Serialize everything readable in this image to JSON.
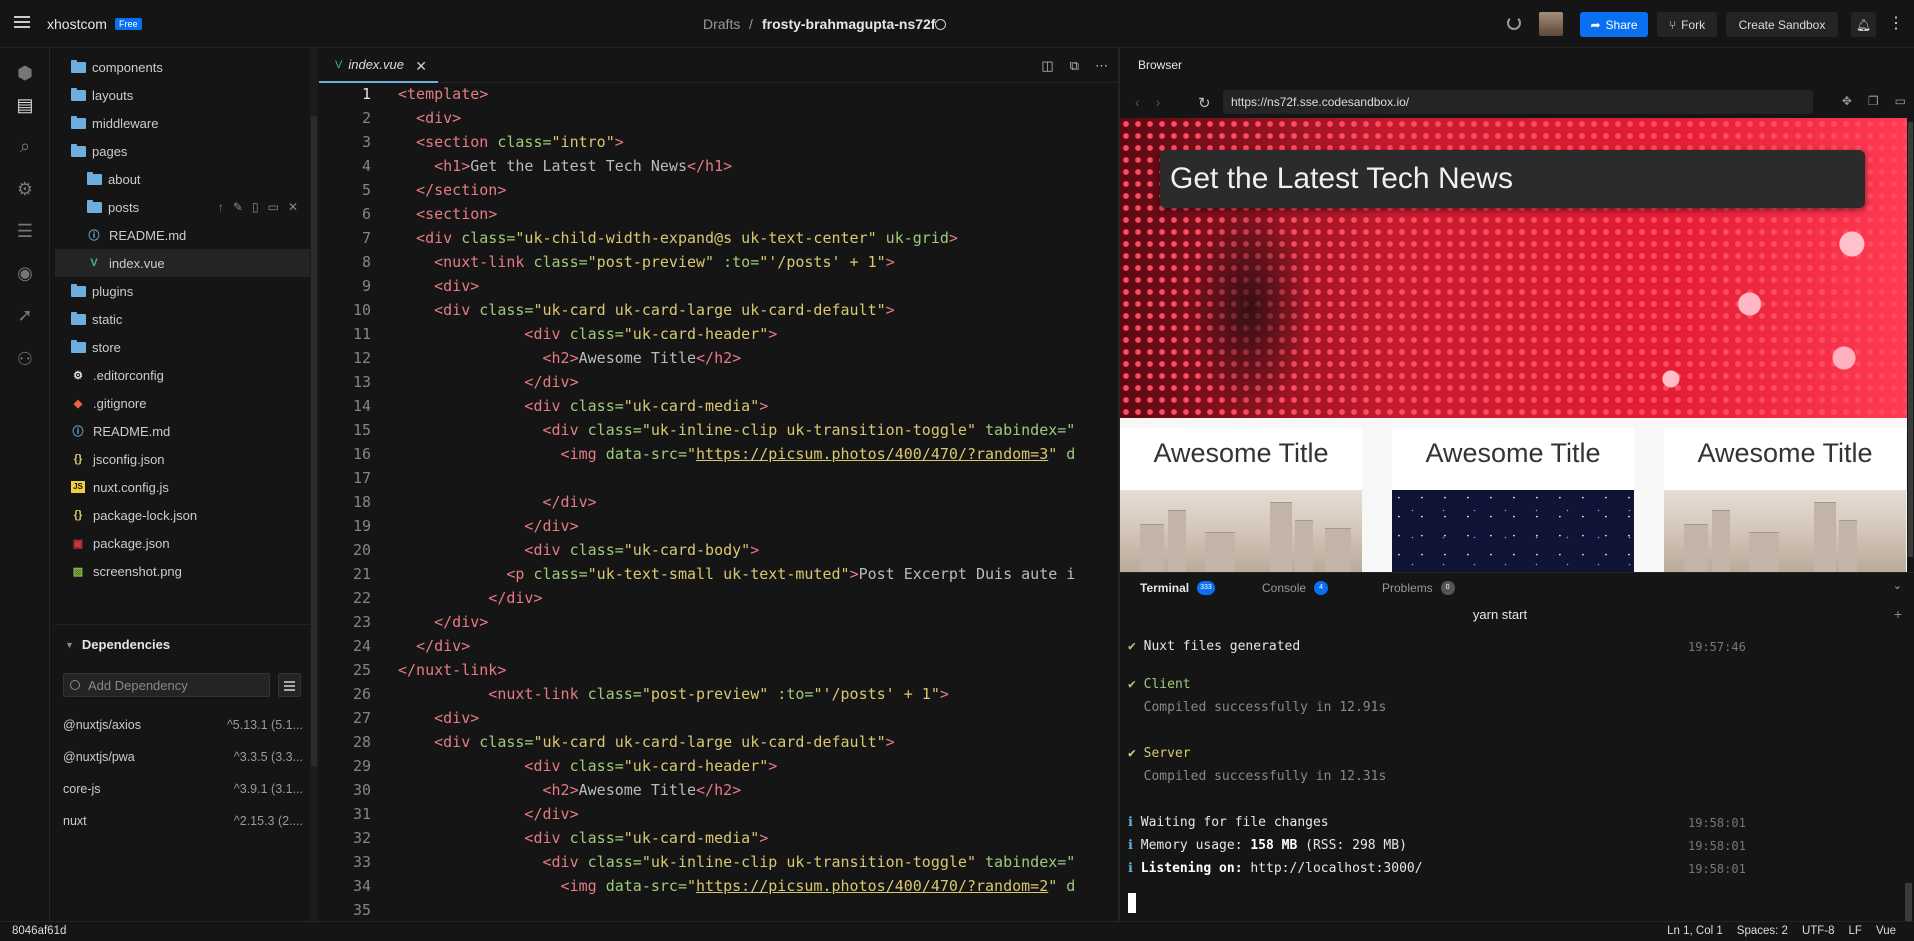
{
  "topbar": {
    "brand": "xhostcom",
    "plan_badge": "Free",
    "crumb": "Drafts",
    "separator": "/",
    "sandbox_name": "frosty-brahmagupta-ns72f",
    "share": "Share",
    "fork": "Fork",
    "create": "Create Sandbox"
  },
  "explorer": {
    "files": [
      {
        "name": "components",
        "type": "folder"
      },
      {
        "name": "layouts",
        "type": "folder"
      },
      {
        "name": "middleware",
        "type": "folder"
      },
      {
        "name": "pages",
        "type": "folder"
      },
      {
        "name": "about",
        "type": "folder"
      },
      {
        "name": "posts",
        "type": "folder"
      },
      {
        "name": "README.md",
        "type": "info"
      },
      {
        "name": "index.vue",
        "type": "vue"
      },
      {
        "name": "plugins",
        "type": "folder"
      },
      {
        "name": "static",
        "type": "folder"
      },
      {
        "name": "store",
        "type": "folder"
      },
      {
        "name": ".editorconfig",
        "type": "config"
      },
      {
        "name": ".gitignore",
        "type": "git"
      },
      {
        "name": "README.md",
        "type": "info"
      },
      {
        "name": "jsconfig.json",
        "type": "json"
      },
      {
        "name": "nuxt.config.js",
        "type": "js"
      },
      {
        "name": "package-lock.json",
        "type": "json"
      },
      {
        "name": "package.json",
        "type": "npm"
      },
      {
        "name": "screenshot.png",
        "type": "image"
      }
    ],
    "dependencies_title": "Dependencies",
    "add_dependency_placeholder": "Add Dependency",
    "dependencies": [
      {
        "name": "@nuxtjs/axios",
        "version": "^5.13.1 (5.1..."
      },
      {
        "name": "@nuxtjs/pwa",
        "version": "^3.3.5 (3.3..."
      },
      {
        "name": "core-js",
        "version": "^3.9.1 (3.1..."
      },
      {
        "name": "nuxt",
        "version": "^2.15.3 (2...."
      }
    ]
  },
  "editor": {
    "tab": "index.vue",
    "lines": [
      "1",
      "2",
      "3",
      "4",
      "5",
      "6",
      "7",
      "8",
      "9",
      "10",
      "11",
      "12",
      "13",
      "14",
      "15",
      "16",
      "17",
      "18",
      "19",
      "20",
      "21",
      "22",
      "23",
      "24",
      "25",
      "26",
      "27",
      "28",
      "29",
      "30",
      "31",
      "32",
      "33",
      "34",
      "35"
    ],
    "code": {
      "l1": "<template>",
      "l2": "  <div>",
      "l3a": "  <section ",
      "l3b": "class=",
      "l3c": "\"intro\"",
      "l3d": ">",
      "l4a": "    <h1>",
      "l4b": "Get the Latest Tech News",
      "l4c": "</h1>",
      "l5": "  </section>",
      "l6": "  <section>",
      "l7a": "  <div ",
      "l7b": "class=",
      "l7c": "\"uk-child-width-expand@s uk-text-center\"",
      "l7d": " uk-grid",
      ">": ">",
      "l8a": "    <nuxt-link ",
      "l8b": "class=",
      "l8c": "\"post-preview\"",
      "l8d": " :to=",
      "l8e": "\"'/posts' + 1\"",
      "l8f": ">",
      "l9": "    <div>",
      "l10a": "    <div ",
      "l10b": "class=",
      "l10c": "\"uk-card uk-card-large uk-card-default\"",
      "l10d": ">",
      "l11a": "              <div ",
      "l11b": "class=",
      "l11c": "\"uk-card-header\"",
      "l11d": ">",
      "l12a": "                <h2>",
      "l12b": "Awesome Title",
      "l12c": "</h2>",
      "l13": "              </div>",
      "l14a": "              <div ",
      "l14b": "class=",
      "l14c": "\"uk-card-media\"",
      "l14d": ">",
      "l15a": "                <div ",
      "l15b": "class=",
      "l15c": "\"uk-inline-clip uk-transition-toggle\"",
      "l15d": " tabindex=\"",
      "l16a": "                  <img ",
      "l16b": "data-src=",
      "l16c": "\"",
      "l16d": "https://picsum.photos/400/470/?random=3",
      "l16e": "\"",
      "l16f": " d",
      "l18": "                </div>",
      "l19": "              </div>",
      "l20a": "              <div ",
      "l20b": "class=",
      "l20c": "\"uk-card-body\"",
      "l20d": ">",
      "l21a": "            <p ",
      "l21b": "class=",
      "l21c": "\"uk-text-small uk-text-muted\"",
      "l21d": ">",
      "l21e": "Post Excerpt Duis aute i",
      "l22": "          </div>",
      "l23": "    </div>",
      "l24": "  </div>",
      "l25": "</nuxt-link>",
      "l26a": "          <nuxt-link ",
      "l26b": "class=",
      "l26c": "\"post-preview\"",
      "l26d": " :to=",
      "l26e": "\"'/posts' + 1\"",
      "l26f": ">",
      "l27": "    <div>",
      "l28a": "    <div ",
      "l28b": "class=",
      "l28c": "\"uk-card uk-card-large uk-card-default\"",
      "l28d": ">",
      "l29a": "              <div ",
      "l29b": "class=",
      "l29c": "\"uk-card-header\"",
      "l29d": ">",
      "l30a": "                <h2>",
      "l30b": "Awesome Title",
      "l30c": "</h2>",
      "l31": "              </div>",
      "l32a": "              <div ",
      "l32b": "class=",
      "l32c": "\"uk-card-media\"",
      "l32d": ">",
      "l33a": "                <div ",
      "l33b": "class=",
      "l33c": "\"uk-inline-clip uk-transition-toggle\"",
      "l33d": " tabindex=\"",
      "l34a": "                  <img ",
      "l34b": "data-src=",
      "l34c": "\"",
      "l34d": "https://picsum.photos/400/470/?random=2",
      "l34e": "\"",
      "l34f": " d"
    }
  },
  "browser": {
    "title": "Browser",
    "url": "https://ns72f.sse.codesandbox.io/",
    "hero_title": "Get the Latest Tech News",
    "cards": [
      "Awesome Title",
      "Awesome Title",
      "Awesome Title"
    ]
  },
  "terminal": {
    "tabs": [
      {
        "label": "Terminal",
        "badge": "333"
      },
      {
        "label": "Console",
        "badge": "4"
      },
      {
        "label": "Problems",
        "badge": "0"
      }
    ],
    "command": "yarn start",
    "log": {
      "gen_mark": "✔",
      "gen": " Nuxt files generated",
      "gen_time": "19:57:46",
      "client_mark": "✔",
      "client": " Client",
      "client_msg": "  Compiled successfully in 12.91s",
      "server_mark": "✔",
      "server": " Server",
      "server_msg": "  Compiled successfully in 12.31s",
      "i": "ℹ",
      "wait": " Waiting for file changes",
      "wait_time": "19:58:01",
      "mem_a": " Memory usage: ",
      "mem_b": "158 MB",
      "mem_c": " (RSS: 298 MB)",
      "mem_time": "19:58:01",
      "listen_a": " Listening on: ",
      "listen_b": "http://localhost:3000/",
      "listen_time": "19:58:01"
    }
  },
  "status": {
    "commit": "8046af61d",
    "position": "Ln 1, Col 1",
    "spaces": "Spaces: 2",
    "encoding": "UTF-8",
    "eol": "LF",
    "language": "Vue"
  },
  "colors": {
    "accent": "#0971f1",
    "vue": "#41b883",
    "folder": "#6caedd"
  }
}
